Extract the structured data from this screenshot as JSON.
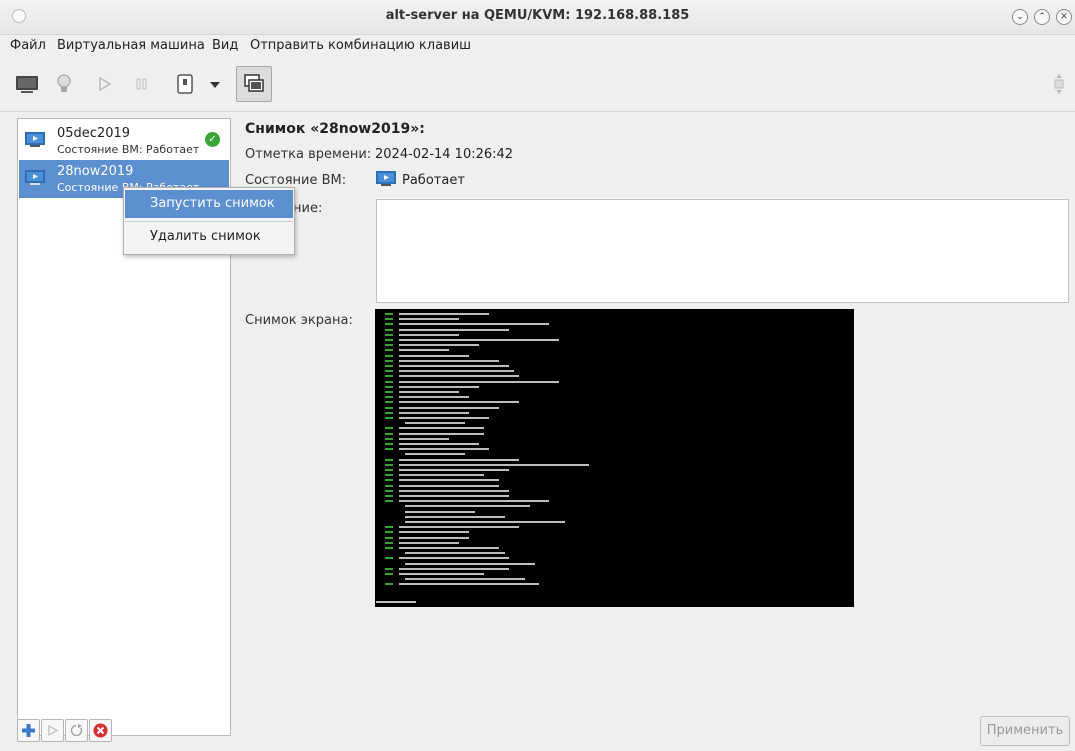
{
  "window": {
    "title": "alt-server на QEMU/KVM: 192.168.88.185"
  },
  "menu": {
    "file": "Файл",
    "vm": "Виртуальная машина",
    "view": "Вид",
    "send_keys": "Отправить комбинацию клавиш"
  },
  "toolbar": {
    "icons": [
      "monitor-icon",
      "lightbulb-icon",
      "play-icon",
      "pause-icon",
      "power-icon",
      "dropdown-arrow-icon",
      "snapshots-icon",
      "resize-icon"
    ]
  },
  "snapshots": [
    {
      "name": "05dec2019",
      "state": "Состояние ВМ: Работает",
      "current": true
    },
    {
      "name": "28now2019",
      "state": "Состояние ВМ: Работает",
      "current": false
    }
  ],
  "context_menu": {
    "run": "Запустить снимок",
    "delete": "Удалить снимок"
  },
  "details": {
    "title": "Снимок «28now2019»:",
    "timestamp_label": "Отметка времени:",
    "timestamp_value": "2024-02-14 10:26:42",
    "state_label": "Состояние ВМ:",
    "state_value": "Работает",
    "description_label_visible": "ние:",
    "screenshot_label": "Снимок экрана:"
  },
  "bottom": {
    "apply": "Применить",
    "icons": [
      "add-icon",
      "run-icon",
      "refresh-icon",
      "delete-icon"
    ]
  },
  "colors": {
    "selection": "#5b8fd0",
    "ok_green": "#3aa63a",
    "delete_red": "#d33030"
  }
}
